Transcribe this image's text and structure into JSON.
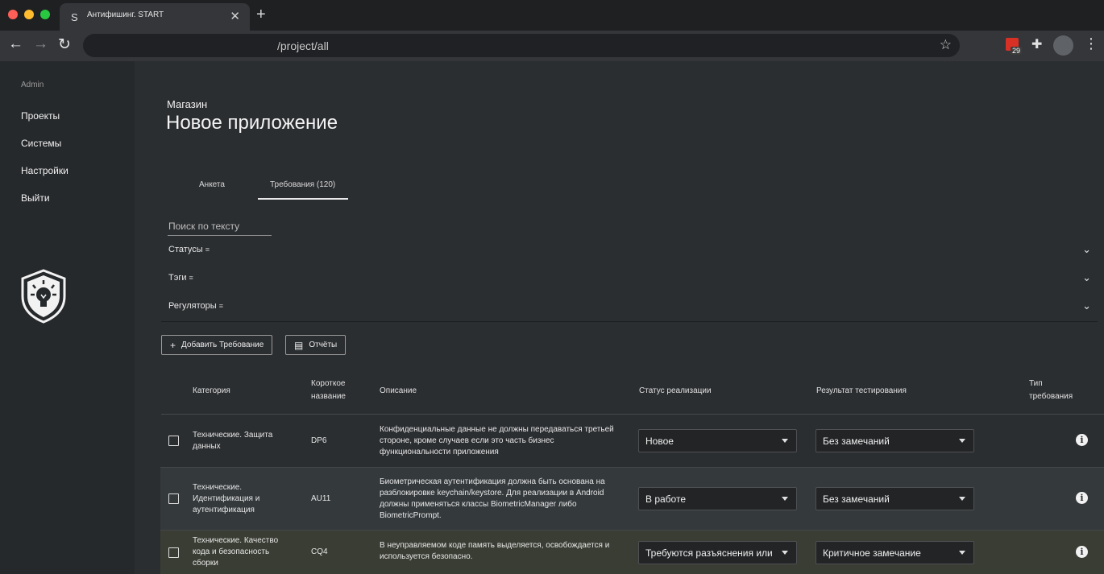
{
  "browser": {
    "tab_favicon": "S",
    "tab_title": "Антифишинг. START",
    "tab_close": "✕",
    "new_tab": "+",
    "back": "←",
    "forward": "→",
    "reload": "↻",
    "url": "/project/all",
    "star": "☆",
    "ext_badge": "29",
    "ext_puzzle": "✚",
    "menu": "⋮"
  },
  "sidebar": {
    "user": "Admin",
    "items": [
      {
        "label": "Проекты"
      },
      {
        "label": "Системы"
      },
      {
        "label": "Настройки"
      },
      {
        "label": "Выйти"
      }
    ]
  },
  "header": {
    "subtitle": "Магазин",
    "title": "Новое приложение"
  },
  "tabs": [
    {
      "label": "Анкета"
    },
    {
      "label": "Требования (120)"
    }
  ],
  "search": {
    "placeholder": "Поиск по тексту"
  },
  "filters": [
    {
      "label": "Статусы"
    },
    {
      "label": "Тэги"
    },
    {
      "label": "Регуляторы"
    }
  ],
  "actions": {
    "add_label": "Добавить Требование",
    "reports_label": "Отчёты"
  },
  "table": {
    "headers": {
      "category": "Категория",
      "short_name_1": "Короткое",
      "short_name_2": "название",
      "description": "Описание",
      "impl_status": "Статус реализации",
      "test_result": "Результат тестирования",
      "type_1": "Тип",
      "type_2": "требования"
    },
    "rows": [
      {
        "category_lines": [
          "Технические. Защита",
          "данных"
        ],
        "short_name": "DP6",
        "description_lines": [
          "Конфиденциальные данные не должны передаваться третьей",
          "стороне, кроме случаев если это часть бизнес",
          "функциональности приложения"
        ],
        "impl_status": "Новое",
        "test_result": "Без замечаний"
      },
      {
        "category_lines": [
          "Технические.",
          "Идентификация и",
          "аутентификация"
        ],
        "short_name": "AU11",
        "description_lines": [
          "Биометрическая аутентификация должна быть основана на",
          "разблокировке keychain/keystore. Для реализации в Android",
          "должны применяться классы BiometricManager либо",
          "BiometricPrompt."
        ],
        "impl_status": "В работе",
        "test_result": "Без замечаний"
      },
      {
        "category_lines": [
          "Технические. Качество",
          "кода и безопасность",
          "сборки"
        ],
        "short_name": "CQ4",
        "description_lines": [
          "В неуправляемом коде память выделяется, освобождается и",
          "используется безопасно."
        ],
        "impl_status": "Требуются разъяснения или",
        "test_result": "Критичное замечание"
      }
    ]
  },
  "icons": {
    "plus": "+",
    "report": "▤",
    "filter": "≡",
    "chevron": "⌄",
    "info": "i"
  }
}
